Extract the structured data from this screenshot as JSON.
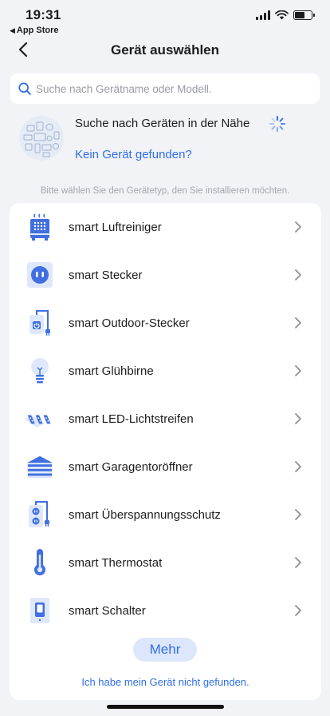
{
  "status_bar": {
    "time": "19:31",
    "back_app_label": "App Store"
  },
  "nav": {
    "title": "Gerät auswählen"
  },
  "search": {
    "placeholder": "Suche nach Gerätname oder Modell."
  },
  "nearby": {
    "searching_text": "Suche nach Geräten in der Nähe",
    "not_found_link": "Kein Gerät gefunden?"
  },
  "hint": "Bitte wählen Sie den Gerätetyp, den Sie installieren möchten.",
  "devices": [
    {
      "label": "smart Luftreiniger",
      "icon": "air-purifier-icon"
    },
    {
      "label": "smart Stecker",
      "icon": "plug-icon"
    },
    {
      "label": "smart Outdoor-Stecker",
      "icon": "outdoor-plug-icon"
    },
    {
      "label": "smart Glühbirne",
      "icon": "bulb-icon"
    },
    {
      "label": "smart LED-Lichtstreifen",
      "icon": "led-strip-icon"
    },
    {
      "label": "smart Garagentoröffner",
      "icon": "garage-door-icon"
    },
    {
      "label": "smart Überspannungsschutz",
      "icon": "surge-protector-icon"
    },
    {
      "label": "smart Thermostat",
      "icon": "thermostat-icon"
    },
    {
      "label": "smart Schalter",
      "icon": "switch-icon"
    }
  ],
  "more_button": "Mehr",
  "bottom_link": "Ich habe mein Gerät nicht gefunden.",
  "colors": {
    "accent": "#2f6ee8",
    "icon_blue": "#3f6fe0",
    "icon_light": "#dfe7fb",
    "background": "#f2f3f7"
  }
}
